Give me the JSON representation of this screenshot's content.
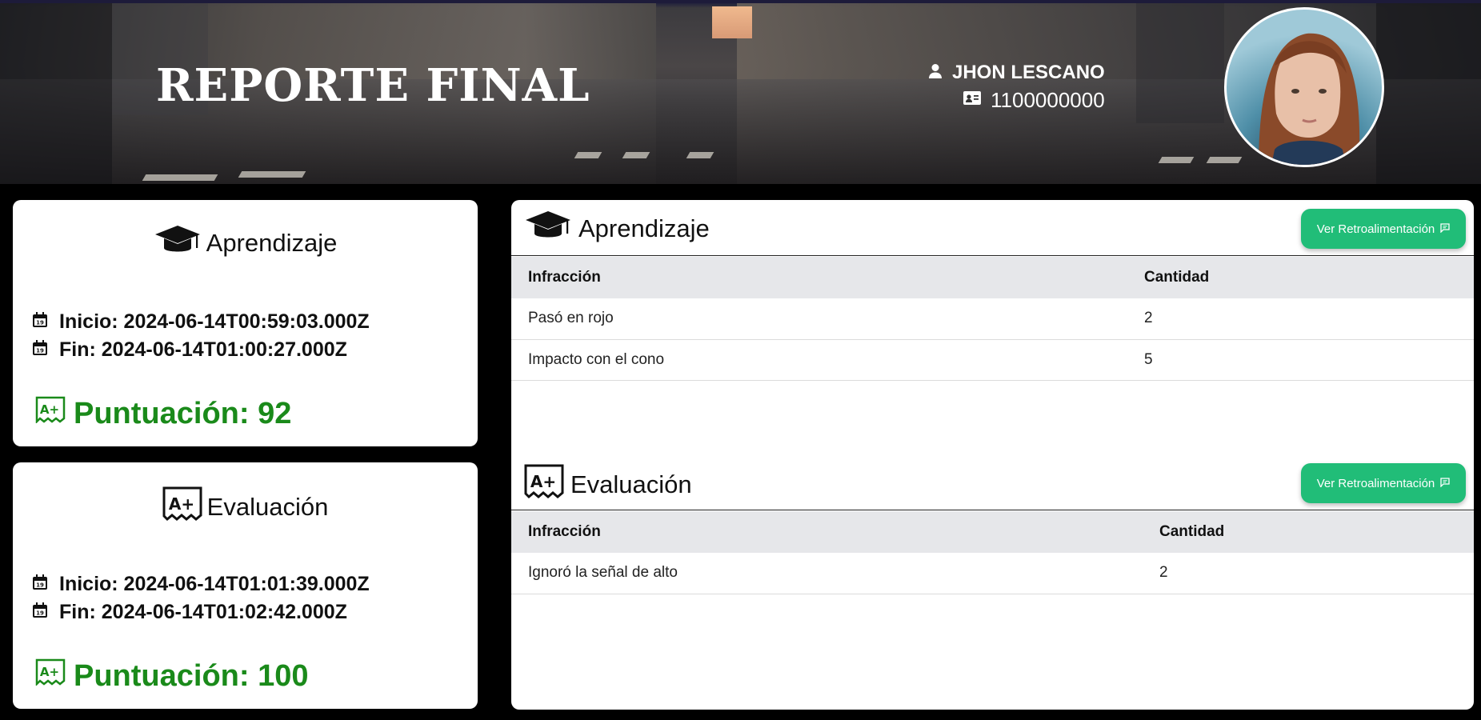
{
  "header": {
    "title": "REPORTE FINAL",
    "user_name": "JHON LESCANO",
    "user_id": "1100000000"
  },
  "left": {
    "learning": {
      "title": "Aprendizaje",
      "start": "Inicio: 2024-06-14T00:59:03.000Z",
      "end": "Fin: 2024-06-14T01:00:27.000Z",
      "score": "Puntuación: 92"
    },
    "evaluation": {
      "title": "Evaluación",
      "start": "Inicio: 2024-06-14T01:01:39.000Z",
      "end": "Fin: 2024-06-14T01:02:42.000Z",
      "score": "Puntuación: 100"
    }
  },
  "right": {
    "learning": {
      "title": "Aprendizaje",
      "button": "Ver Retroalimentación",
      "columns": [
        "Infracción",
        "Cantidad"
      ],
      "rows": [
        [
          "Pasó en rojo",
          "2"
        ],
        [
          "Impacto con el cono",
          "5"
        ]
      ]
    },
    "evaluation": {
      "title": "Evaluación",
      "button": "Ver Retroalimentación",
      "columns": [
        "Infracción",
        "Cantidad"
      ],
      "rows": [
        [
          "Ignoró la señal de alto",
          "2"
        ]
      ]
    }
  },
  "icons": {
    "learning": "graduation-cap-icon",
    "evaluation": "grade-a-plus-icon",
    "calendar": "calendar-icon",
    "user": "user-icon",
    "id_card": "id-card-icon",
    "feedback": "message-square-icon"
  },
  "colors": {
    "accent_button": "#21bd78",
    "score_green": "#1a8a1a"
  }
}
